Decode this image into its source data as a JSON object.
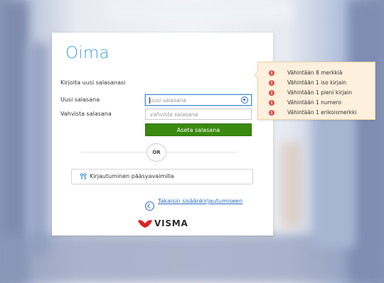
{
  "app": {
    "logo": "Oima",
    "brand": "VISMA"
  },
  "form": {
    "heading": "Kirjoita uusi salasanasi",
    "new_password_label": "Uusi salasana",
    "new_password_placeholder": "uusi salasana",
    "confirm_password_label": "Vahvista salasana",
    "confirm_password_placeholder": "vahvista salasana",
    "submit_label": "Aseta salasana",
    "or_label": "OR",
    "passkey_label": "Kirjautuminen pääsyavaimilla",
    "back_link": "Takaisin sisäänkirjautumiseen"
  },
  "requirements": [
    {
      "text": "Vähintään 8 merkkiä",
      "icon": "error-icon"
    },
    {
      "text": "Vähintään 1 iso kirjain",
      "icon": "error-icon"
    },
    {
      "text": "Vähintään 1 pieni kirjain",
      "icon": "error-icon"
    },
    {
      "text": "Vähintään 1 numero",
      "icon": "error-icon"
    },
    {
      "text": "Vähintään 1 erikoismerkki",
      "icon": "error-icon"
    }
  ],
  "colors": {
    "brand_blue": "#3d9fd8",
    "submit_green": "#3a8a0f",
    "error_red": "#d9534f",
    "visma_red": "#d8232a",
    "tooltip_bg": "#fdf0dc"
  }
}
